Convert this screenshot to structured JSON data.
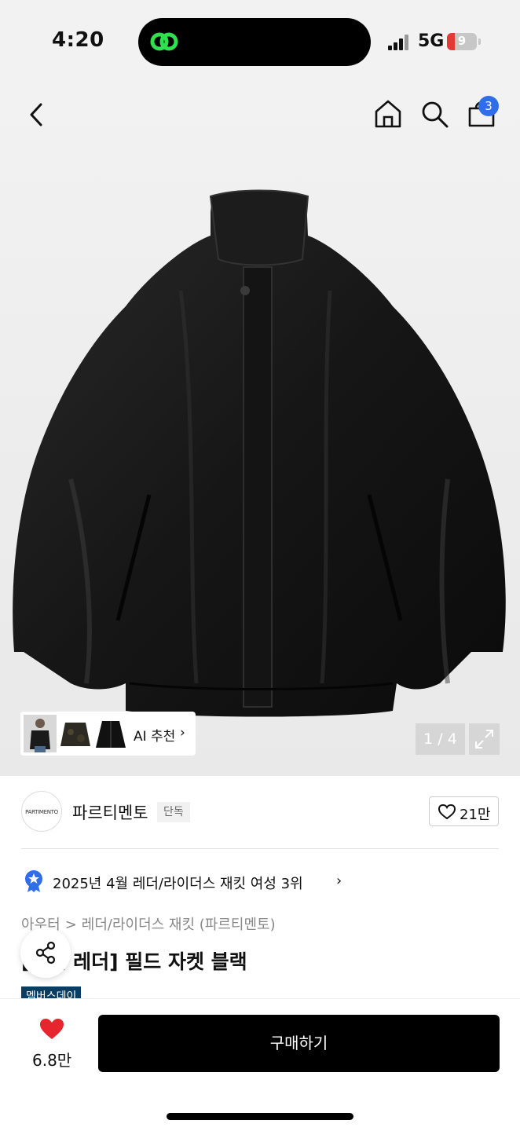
{
  "status_bar": {
    "time": "4:20",
    "network": "5G",
    "battery": "9",
    "signal_bars": 4
  },
  "nav": {
    "cart_count": "3",
    "icons": [
      "back-icon",
      "home-icon",
      "search-icon",
      "cart-icon"
    ]
  },
  "gallery": {
    "ai_label": "AI 추천",
    "ai_chevron": "›",
    "pager": "1 / 4",
    "thumbnails": [
      "thumb-model",
      "thumb-camo-jacket",
      "thumb-leather-jacket"
    ]
  },
  "brand": {
    "logo_text": "PARTIMENTO",
    "name": "파르티멘토",
    "tag": "단독",
    "likes": "21만"
  },
  "ranking": {
    "text": "2025년 4월 레더/라이더스 재킷 여성 3위",
    "chevron": "›"
  },
  "breadcrumb": {
    "category": "아우터",
    "separator": ">",
    "sub": "레더/라이더스 재킷 (파르티멘토)"
  },
  "product": {
    "title": "[비건 레더] 필드 자켓 블랙",
    "member_tag": "멤버스데이"
  },
  "bottom_bar": {
    "wish_count": "6.8만",
    "buy_label": "구매하기"
  },
  "colors": {
    "accent_blue": "#2f6ee8",
    "heart_red": "#e6262e",
    "island_green": "#2fe04f",
    "member_navy": "#0a3d62"
  }
}
